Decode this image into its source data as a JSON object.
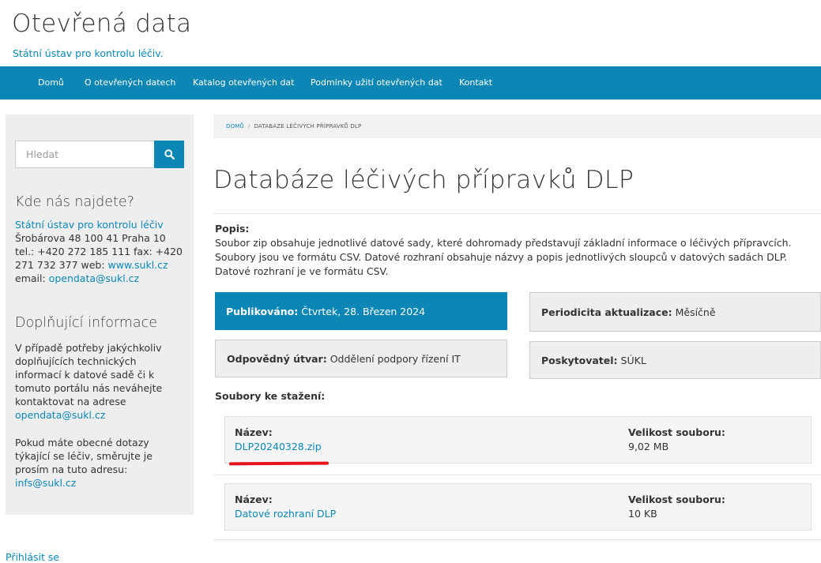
{
  "site": {
    "title": "Otevřená data",
    "subtitle": "Státní ústav pro kontrolu léčiv."
  },
  "nav": {
    "items": [
      "Domů",
      "O otevřených datech",
      "Katalog otevřených dat",
      "Podmínky užití otevřených dat",
      "Kontakt"
    ]
  },
  "sidebar": {
    "search_placeholder": "Hledat",
    "search_icon": "search-icon",
    "contact_heading": "Kde nás najdete?",
    "contact_link": "Státní ústav pro kontrolu léčiv",
    "contact_address": "Šrobárova 48 100 41 Praha 10",
    "contact_phone": "tel.: +420 272 185 111 fax: +420",
    "contact_fax_web_prefix": "271 732 377 web: ",
    "contact_web": "www.sukl.cz",
    "contact_email_prefix": "email: ",
    "contact_email": "opendata@sukl.cz",
    "info_heading": "Doplňující informace",
    "info_text_1": "V případě potřeby jakýchkoliv doplňujících technických informací k datové sadě či k tomuto portálu nás neváhejte kontaktovat na adrese",
    "info_email_1": "opendata@sukl.cz",
    "info_text_2": "Pokud máte obecné dotazy týkající se léčiv, směrujte je prosím na tuto adresu:",
    "info_email_2": "infs@sukl.cz"
  },
  "breadcrumb": {
    "home": "DOMŮ",
    "separator": "/",
    "current": "DATABÁZE LÉČIVÝCH PŘÍPRAVKŮ DLP"
  },
  "page": {
    "title": "Databáze léčivých přípravků DLP",
    "description_label": "Popis:",
    "description_line_1": "Soubor zip obsahuje jednotlivé datové sady, které dohromady představují základní informace o léčivých přípravcích.",
    "description_line_2": "Soubory jsou ve formátu CSV. Datové rozhraní obsahuje názvy a popis jednotlivých sloupců v datových sadách DLP.",
    "description_line_3": "Datové rozhraní je ve formátu CSV.",
    "published_label": "Publikováno:",
    "published_value": "Čtvrtek, 28. Březen 2024",
    "periodicity_label": "Periodicita aktualizace:",
    "periodicity_value": "Měsíčně",
    "department_label": "Odpovědný útvar:",
    "department_value": "Oddělení podpory řízení IT",
    "provider_label": "Poskytovatel:",
    "provider_value": "SÚKL",
    "files_label": "Soubory ke stažení:"
  },
  "files": [
    {
      "name_label": "Název:",
      "name": "DLP20240328.zip",
      "size_label": "Velikost souboru:",
      "size": "9,02 MB"
    },
    {
      "name_label": "Název:",
      "name": "Datové rozhraní DLP",
      "size_label": "Velikost souboru:",
      "size": "10 KB"
    }
  ],
  "footer": {
    "login": "Přihlásit se"
  },
  "colors": {
    "brand": "#0c86b4",
    "link": "#0a87b8",
    "highlight": "#e5141b"
  }
}
